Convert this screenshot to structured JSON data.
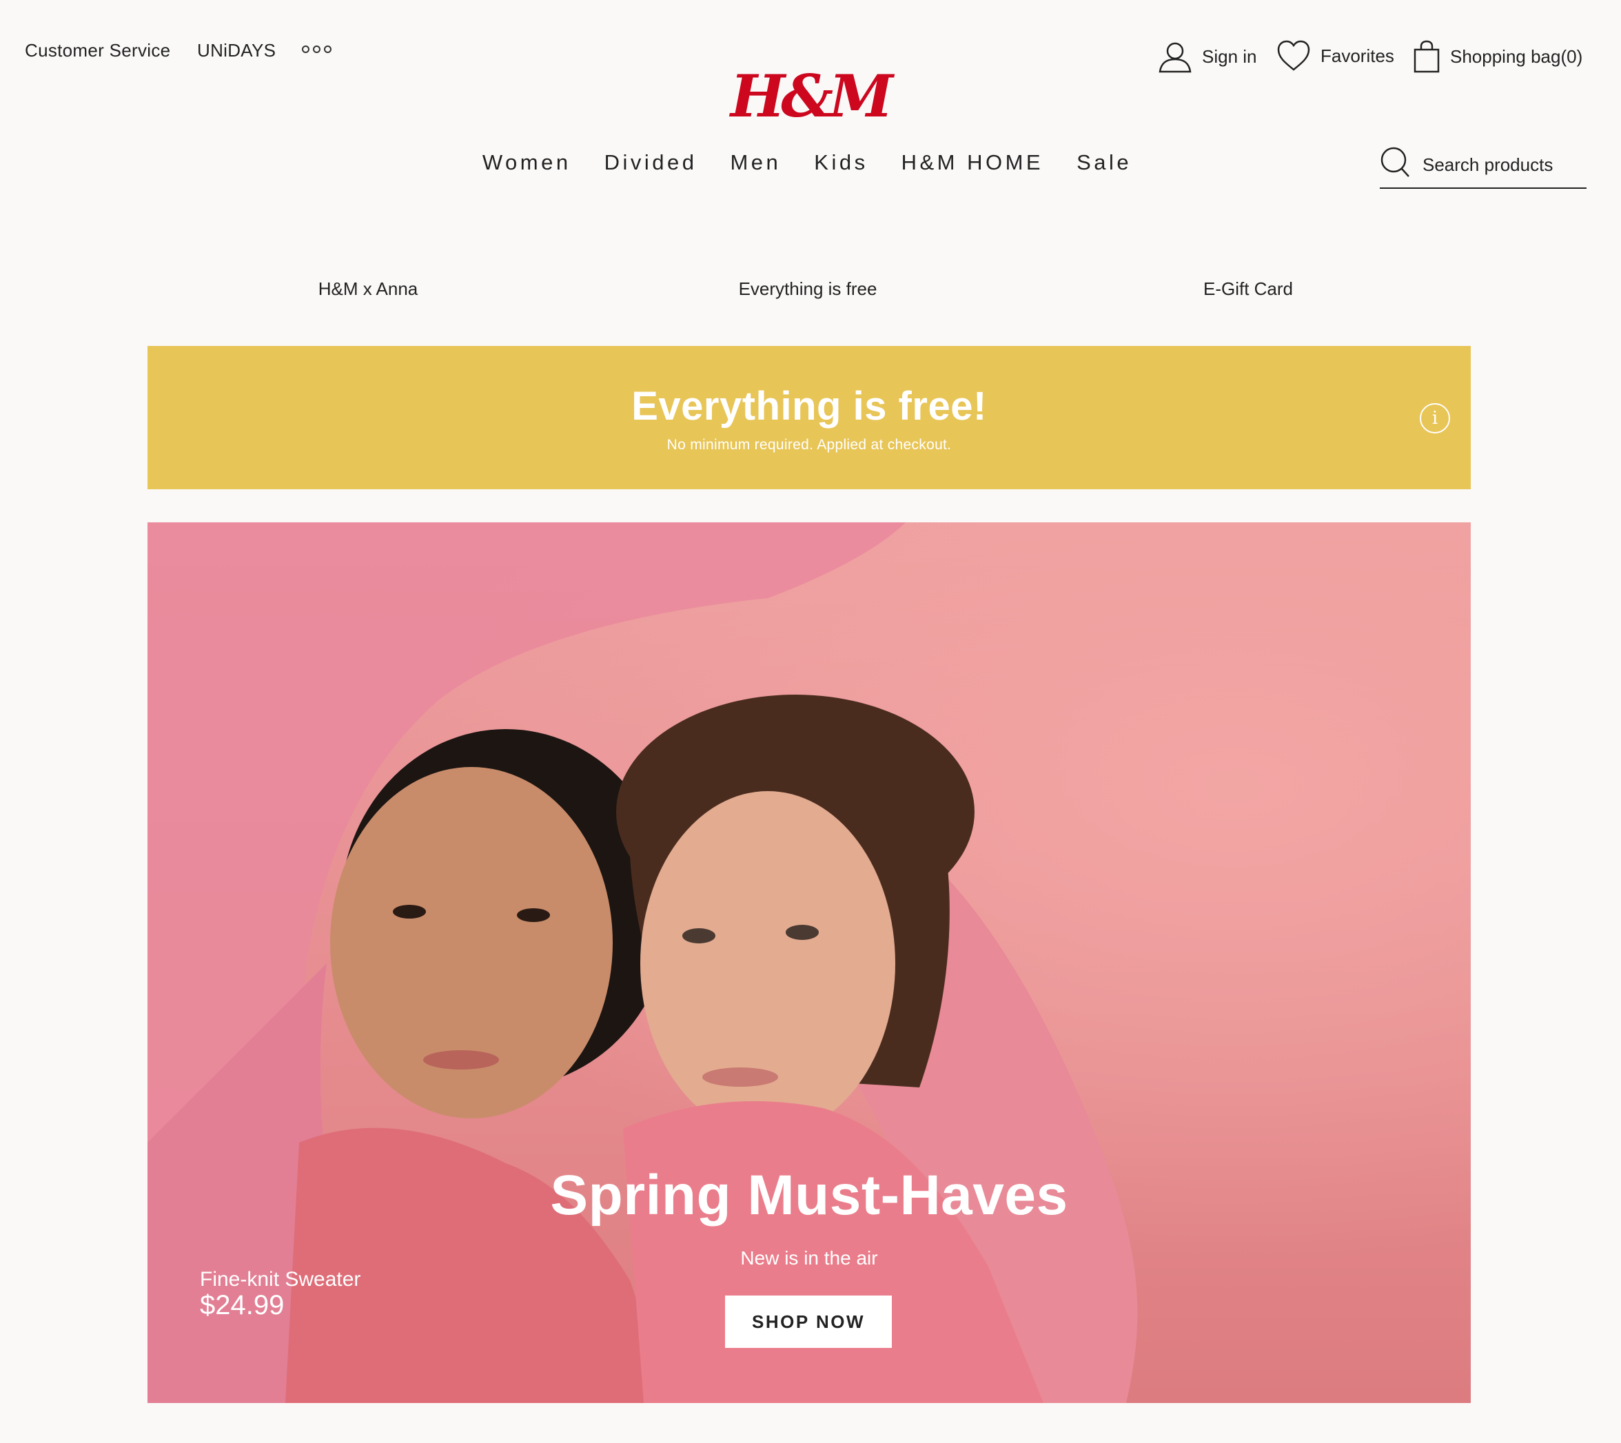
{
  "utility_nav": {
    "customer_service": "Customer Service",
    "unidays": "UNiDAYS",
    "more_icon": "more-dots-icon"
  },
  "logo": {
    "text": "H&M",
    "color": "#cc071e"
  },
  "account": {
    "sign_in": "Sign in",
    "favorites": "Favorites",
    "shopping_bag": "Shopping bag(0)"
  },
  "main_nav": {
    "items": [
      "Women",
      "Divided",
      "Men",
      "Kids",
      "H&M HOME",
      "Sale"
    ]
  },
  "search": {
    "placeholder": "Search products",
    "icon": "search-icon"
  },
  "sub_nav": {
    "items": [
      "H&M x Anna",
      "Everything is free",
      "E-Gift Card"
    ]
  },
  "promo": {
    "title": "Everything is free!",
    "subtitle": "No minimum required. Applied at checkout.",
    "background": "#e8c557",
    "icon": "info-icon"
  },
  "hero": {
    "title": "Spring Must-Haves",
    "subtitle": "New is in the air",
    "cta": "SHOP NOW",
    "product_name": "Fine-knit Sweater",
    "product_price": "$24.99",
    "accent": "#e8928f"
  }
}
